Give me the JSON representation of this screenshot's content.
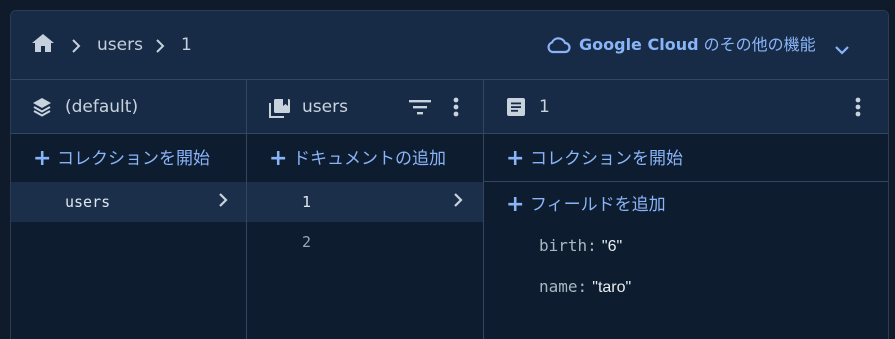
{
  "breadcrumb": {
    "items": [
      "users",
      "1"
    ]
  },
  "cloud_link": {
    "brand": "Google Cloud",
    "suffix": " のその他の機能"
  },
  "columns": {
    "root": {
      "header": "(default)",
      "add_action": "コレクションを開始",
      "items": [
        "users"
      ]
    },
    "collection": {
      "header": "users",
      "add_action": "ドキュメントの追加",
      "items": [
        "1",
        "2"
      ]
    },
    "document": {
      "header": "1",
      "add_collection": "コレクションを開始",
      "add_field": "フィールドを追加",
      "fields": [
        {
          "key": "birth:",
          "value": "\"6\""
        },
        {
          "key": "name:",
          "value": "\"taro\""
        }
      ]
    }
  },
  "colors": {
    "accent": "#8ab4f8",
    "header_bg": "#172b46",
    "body_bg": "#0d1c2e",
    "selected_bg": "#1b2f4b"
  },
  "icons": [
    "home-icon",
    "chevron-right-icon",
    "cloud-icon",
    "chevron-down-icon",
    "stack-icon",
    "collection-icon",
    "filter-icon",
    "more-vert-icon",
    "document-icon",
    "plus-icon"
  ]
}
